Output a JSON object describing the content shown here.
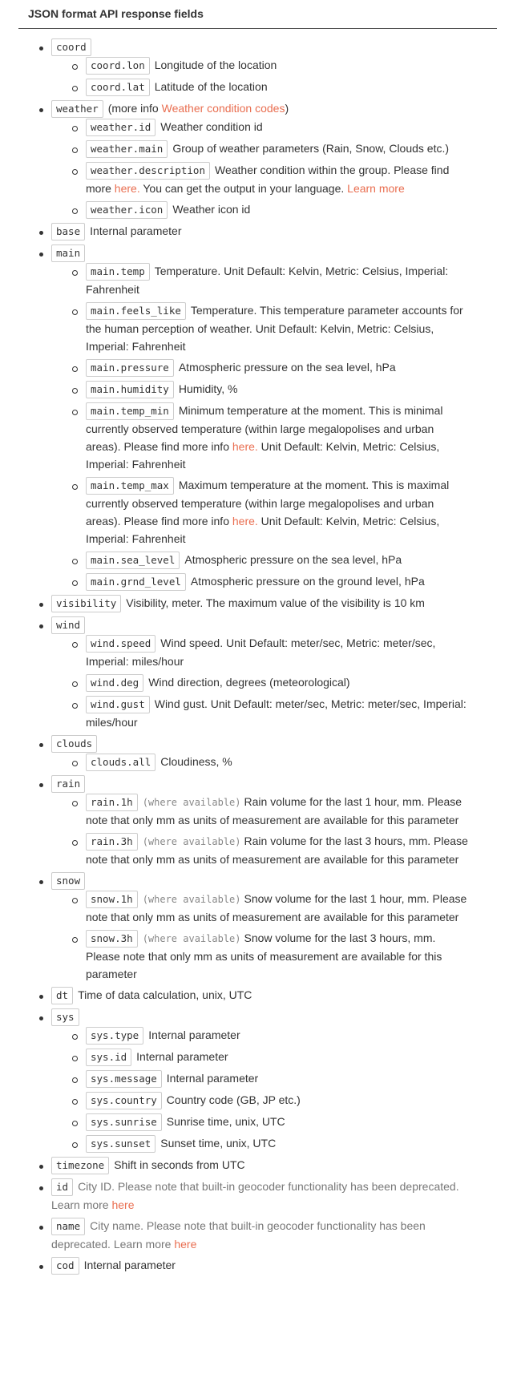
{
  "title": "JSON format API response fields",
  "colors": {
    "link": "#e96e50",
    "text": "#333333",
    "muted": "#777777"
  },
  "items": {
    "coord": {
      "code": "coord",
      "lon": {
        "code": "coord.lon",
        "desc": "Longitude of the location"
      },
      "lat": {
        "code": "coord.lat",
        "desc": "Latitude of the location"
      }
    },
    "weather": {
      "code": "weather",
      "desc_pre": "(more info ",
      "link": "Weather condition codes",
      "desc_post": ")",
      "id": {
        "code": "weather.id",
        "desc": "Weather condition id"
      },
      "main": {
        "code": "weather.main",
        "desc": "Group of weather parameters (Rain, Snow, Clouds etc.)"
      },
      "description": {
        "code": "weather.description",
        "desc1": "Weather condition within the group. Please find more ",
        "link1": "here.",
        "desc2": " You can get the output in your language. ",
        "link2": "Learn more"
      },
      "icon": {
        "code": "weather.icon",
        "desc": "Weather icon id"
      }
    },
    "base": {
      "code": "base",
      "desc": "Internal parameter"
    },
    "main": {
      "code": "main",
      "temp": {
        "code": "main.temp",
        "desc": "Temperature. Unit Default: Kelvin, Metric: Celsius, Imperial: Fahrenheit"
      },
      "feels_like": {
        "code": "main.feels_like",
        "desc": "Temperature. This temperature parameter accounts for the human perception of weather. Unit Default: Kelvin, Metric: Celsius, Imperial: Fahrenheit"
      },
      "pressure": {
        "code": "main.pressure",
        "desc": "Atmospheric pressure on the sea level, hPa"
      },
      "humidity": {
        "code": "main.humidity",
        "desc": "Humidity, %"
      },
      "temp_min": {
        "code": "main.temp_min",
        "desc1": "Minimum temperature at the moment. This is minimal currently observed temperature (within large megalopolises and urban areas). Please find more info ",
        "link": "here.",
        "desc2": " Unit Default: Kelvin, Metric: Celsius, Imperial: Fahrenheit"
      },
      "temp_max": {
        "code": "main.temp_max",
        "desc1": "Maximum temperature at the moment. This is maximal currently observed temperature (within large megalopolises and urban areas). Please find more info ",
        "link": "here.",
        "desc2": " Unit Default: Kelvin, Metric: Celsius, Imperial: Fahrenheit"
      },
      "sea_level": {
        "code": "main.sea_level",
        "desc": "Atmospheric pressure on the sea level, hPa"
      },
      "grnd_level": {
        "code": "main.grnd_level",
        "desc": "Atmospheric pressure on the ground level, hPa"
      }
    },
    "visibility": {
      "code": "visibility",
      "desc": "Visibility, meter. The maximum value of the visibility is 10 km"
    },
    "wind": {
      "code": "wind",
      "speed": {
        "code": "wind.speed",
        "desc": "Wind speed. Unit Default: meter/sec, Metric: meter/sec, Imperial: miles/hour"
      },
      "deg": {
        "code": "wind.deg",
        "desc": "Wind direction, degrees (meteorological)"
      },
      "gust": {
        "code": "wind.gust",
        "desc": "Wind gust. Unit Default: meter/sec, Metric: meter/sec, Imperial: miles/hour"
      }
    },
    "clouds": {
      "code": "clouds",
      "all": {
        "code": "clouds.all",
        "desc": "Cloudiness, %"
      }
    },
    "rain": {
      "code": "rain",
      "h1": {
        "code": "rain.1h",
        "note": "(where available)",
        "desc": "Rain volume for the last 1 hour, mm. Please note that only mm as units of measurement are available for this parameter"
      },
      "h3": {
        "code": "rain.3h",
        "note": "(where available)",
        "desc": "Rain volume for the last 3 hours, mm. Please note that only mm as units of measurement are available for this parameter"
      }
    },
    "snow": {
      "code": "snow",
      "h1": {
        "code": "snow.1h",
        "note": "(where available)",
        "desc": "Snow volume for the last 1 hour, mm. Please note that only mm as units of measurement are available for this parameter"
      },
      "h3": {
        "code": "snow.3h",
        "note": "(where available)",
        "desc": "Snow volume for the last 3 hours, mm. Please note that only mm as units of measurement are available for this parameter"
      }
    },
    "dt": {
      "code": "dt",
      "desc": "Time of data calculation, unix, UTC"
    },
    "sys": {
      "code": "sys",
      "type": {
        "code": "sys.type",
        "desc": "Internal parameter"
      },
      "id": {
        "code": "sys.id",
        "desc": "Internal parameter"
      },
      "message": {
        "code": "sys.message",
        "desc": "Internal parameter"
      },
      "country": {
        "code": "sys.country",
        "desc": "Country code (GB, JP etc.)"
      },
      "sunrise": {
        "code": "sys.sunrise",
        "desc": "Sunrise time, unix, UTC"
      },
      "sunset": {
        "code": "sys.sunset",
        "desc": "Sunset time, unix, UTC"
      }
    },
    "timezone": {
      "code": "timezone",
      "desc": "Shift in seconds from UTC"
    },
    "id": {
      "code": "id",
      "desc": "City ID. Please note that built-in geocoder functionality has been deprecated. Learn more ",
      "link": "here"
    },
    "name": {
      "code": "name",
      "desc": "City name. Please note that built-in geocoder functionality has been deprecated. Learn more ",
      "link": "here"
    },
    "cod": {
      "code": "cod",
      "desc": "Internal parameter"
    }
  }
}
